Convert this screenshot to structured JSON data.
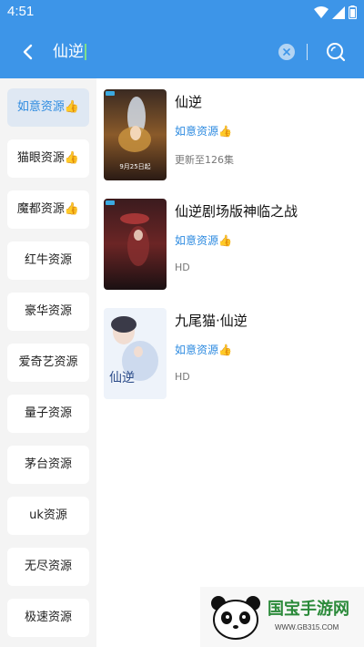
{
  "status": {
    "time": "4:51"
  },
  "search": {
    "query": "仙逆"
  },
  "sidebar": {
    "items": [
      {
        "label": "如意资源👍",
        "active": true
      },
      {
        "label": "猫眼资源👍",
        "active": false
      },
      {
        "label": "魔都资源👍",
        "active": false
      },
      {
        "label": "红牛资源",
        "active": false
      },
      {
        "label": "豪华资源",
        "active": false
      },
      {
        "label": "爱奇艺资源",
        "active": false
      },
      {
        "label": "量子资源",
        "active": false
      },
      {
        "label": "茅台资源",
        "active": false
      },
      {
        "label": "uk资源",
        "active": false
      },
      {
        "label": "无尽资源",
        "active": false
      },
      {
        "label": "极速资源",
        "active": false
      }
    ]
  },
  "results": [
    {
      "title": "仙逆",
      "source": "如意资源👍",
      "status": "更新至126集",
      "poster_text": "9月25日起"
    },
    {
      "title": "仙逆剧场版神临之战",
      "source": "如意资源👍",
      "status": "HD"
    },
    {
      "title": "九尾猫·仙逆",
      "source": "如意资源👍",
      "status": "HD",
      "poster_text": "仙逆"
    }
  ],
  "watermark": {
    "text": "国宝手游网",
    "url": "WWW.GB315.COM"
  },
  "colors": {
    "accent": "#3d95e8",
    "link": "#2e8be0",
    "sidebar_bg": "#f4f4f4"
  }
}
